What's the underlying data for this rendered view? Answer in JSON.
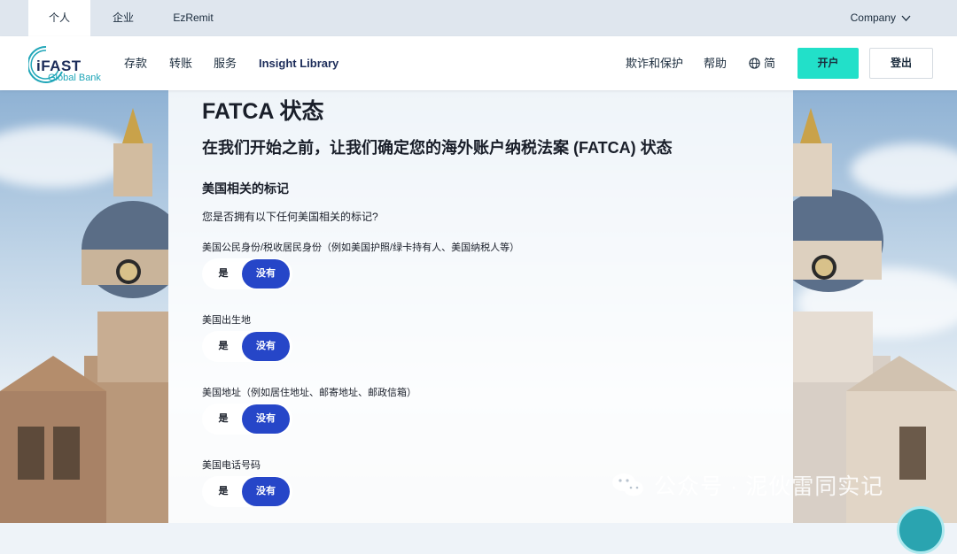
{
  "topbar": {
    "tabs": [
      {
        "label": "个人",
        "active": true
      },
      {
        "label": "企业",
        "active": false
      },
      {
        "label": "EzRemit",
        "active": false
      }
    ],
    "company_label": "Company"
  },
  "navbar": {
    "logo": {
      "brand": "iFAST",
      "sub": "Global Bank"
    },
    "items": [
      {
        "label": "存款"
      },
      {
        "label": "转账"
      },
      {
        "label": "服务"
      },
      {
        "label": "Insight Library"
      }
    ],
    "fraud_label": "欺诈和保护",
    "help_label": "帮助",
    "lang_label": "简",
    "open_account_label": "开户",
    "logout_label": "登出"
  },
  "form": {
    "title": "FATCA 状态",
    "subtitle": "在我们开始之前，让我们确定您的海外账户纳税法案 (FATCA) 状态",
    "section": "美国相关的标记",
    "question": "您是否拥有以下任何美国相关的标记?",
    "items": [
      {
        "label": "美国公民身份/税收居民身份（例如美国护照/绿卡持有人、美国纳税人等）",
        "yes": "是",
        "no": "没有",
        "selected": "no"
      },
      {
        "label": "美国出生地",
        "yes": "是",
        "no": "没有",
        "selected": "no"
      },
      {
        "label": "美国地址（例如居住地址、邮寄地址、邮政信箱）",
        "yes": "是",
        "no": "没有",
        "selected": "no"
      },
      {
        "label": "美国电话号码",
        "yes": "是",
        "no": "没有",
        "selected": "no"
      }
    ]
  },
  "watermark": {
    "text": "公众号 · 泥伙雷同实记",
    "icon": "wechat-icon"
  },
  "colors": {
    "accent": "#2646c8",
    "open_button": "#22e0c9",
    "brand": "#1d2d5a",
    "teal": "#20a6b8"
  }
}
